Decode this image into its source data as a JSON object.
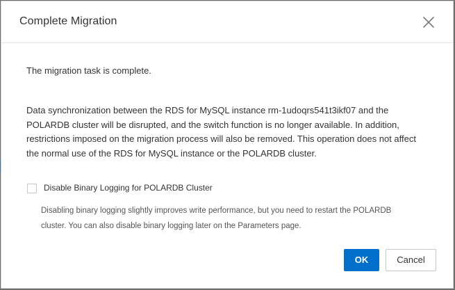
{
  "dialog": {
    "title": "Complete Migration",
    "close_icon": "close-icon",
    "message_complete": "The migration task is complete.",
    "message_detail": "Data synchronization between the RDS for MySQL instance rm-1udoqrs541t3ikf07 and the POLARDB cluster will be disrupted, and the switch function is no longer available. In addition, restrictions imposed on the migration process will also be removed. This operation does not affect the normal use of the RDS for MySQL instance or the POLARDB cluster.",
    "checkbox": {
      "label": "Disable Binary Logging for POLARDB Cluster",
      "checked": false
    },
    "hint": "Disabling binary logging slightly improves write performance, but you need to restart the POLARDB cluster. You can also disable binary logging later on the Parameters page.",
    "buttons": {
      "ok": "OK",
      "cancel": "Cancel"
    }
  },
  "colors": {
    "primary": "#0070cc",
    "overlay": "#6e6e6e",
    "text": "#333333"
  }
}
